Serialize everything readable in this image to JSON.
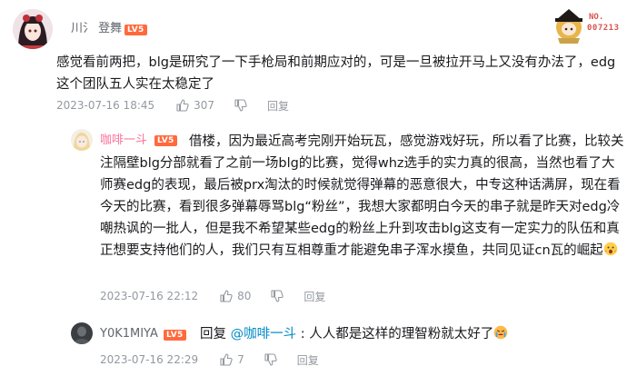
{
  "comment": {
    "username": "川氵 登舞",
    "level": "LV5",
    "text": "感觉看前两把，blg是研究了一下手枪局和前期应对的，可是一旦被拉开马上又没有办法了，edg这个团队五人实在太稳定了",
    "timestamp": "2023-07-16 18:45",
    "likes": "307",
    "reply_label": "回复",
    "fan_badge": {
      "line1": "NO.",
      "line2": "007213"
    }
  },
  "replies": [
    {
      "username": "咖啡一斗",
      "level": "LV5",
      "text": "借楼，因为最近高考完刚开始玩瓦，感觉游戏好玩，所以看了比赛，比较关注隔壁blg分部就看了之前一场blg的比赛，觉得whz选手的实力真的很高，当然也看了大师赛edg的表现，最后被prx淘汰的时候就觉得弹幕的恶意很大，中专这种话满屏，现在看今天的比赛，看到很多弹幕辱骂blg“粉丝”，我想大家都明白今天的串子就是昨天对edg冷嘲热讽的一批人，但是我不希望某些edg的粉丝上升到攻击blg这支有一定实力的队伍和真正想要支持他们的人，我们只有互相尊重才能避免串子浑水摸鱼，共同见证cn瓦的崛起",
      "timestamp": "2023-07-16 22:12",
      "likes": "80",
      "reply_label": "回复"
    },
    {
      "username": "Y0K1MIYA",
      "level": "LV5",
      "prefix": "回复",
      "mention": "@咖啡一斗",
      "text": " : 人人都是这样的理智粉就太好了",
      "timestamp": "2023-07-16 22:29",
      "likes": "7",
      "reply_label": "回复"
    }
  ],
  "colors": {
    "text": "#18191c",
    "meta": "#9499a0",
    "mention": "#008ac5",
    "level_badge": "#ff6a3d"
  }
}
